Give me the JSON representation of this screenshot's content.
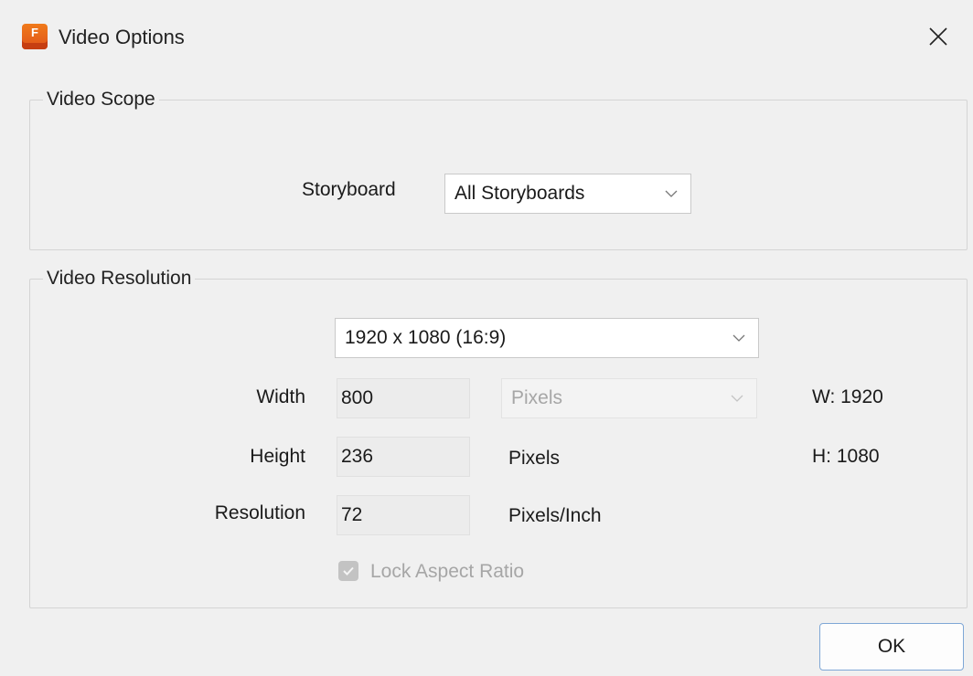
{
  "window": {
    "title": "Video Options",
    "app_icon_letter": "F",
    "app_icon": "app-icon",
    "close_icon": "close-icon"
  },
  "video_scope": {
    "legend": "Video Scope",
    "storyboard_label": "Storyboard",
    "storyboard_value": "All Storyboards"
  },
  "video_resolution": {
    "legend": "Video Resolution",
    "preset_value": "1920 x 1080 (16:9)",
    "width_label": "Width",
    "width_value": "800",
    "width_unit": "Pixels",
    "width_info": "W: 1920",
    "height_label": "Height",
    "height_value": "236",
    "height_unit": "Pixels",
    "height_info": "H: 1080",
    "resolution_label": "Resolution",
    "resolution_value": "72",
    "resolution_unit": "Pixels/Inch",
    "lock_aspect_label": "Lock Aspect Ratio",
    "lock_aspect_checked": true,
    "lock_aspect_enabled": false
  },
  "buttons": {
    "ok_label": "OK"
  },
  "colors": {
    "app_icon": "#e8601a",
    "ok_border": "#7fa7d6",
    "disabled_text": "#a6a6a6"
  }
}
